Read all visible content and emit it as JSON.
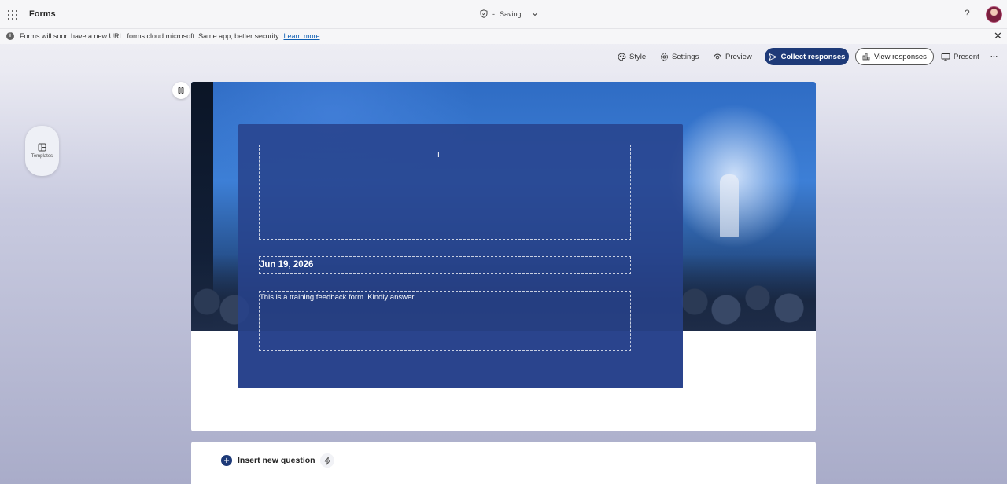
{
  "app": {
    "title": "Forms",
    "status": "Saving..."
  },
  "notice": {
    "info_glyph": "i",
    "message": "Forms will soon have a new URL: forms.cloud.microsoft. Same app, better security.",
    "link": "Learn more"
  },
  "toolbar": {
    "style": "Style",
    "settings": "Settings",
    "preview": "Preview",
    "collect": "Collect responses",
    "view": "View responses",
    "present": "Present"
  },
  "sidebar": {
    "templates": "Templates"
  },
  "form": {
    "title_value": "",
    "date": "Jun 19, 2026",
    "description": "This is a training feedback form. Kindly answer"
  },
  "insert": {
    "label": "Insert new question"
  },
  "help_glyph": "?",
  "close_glyph": "✕",
  "more_glyph": "···",
  "colors": {
    "accent": "#1e3a78",
    "overlay": "#2b4590",
    "link": "#0f5fb3"
  }
}
